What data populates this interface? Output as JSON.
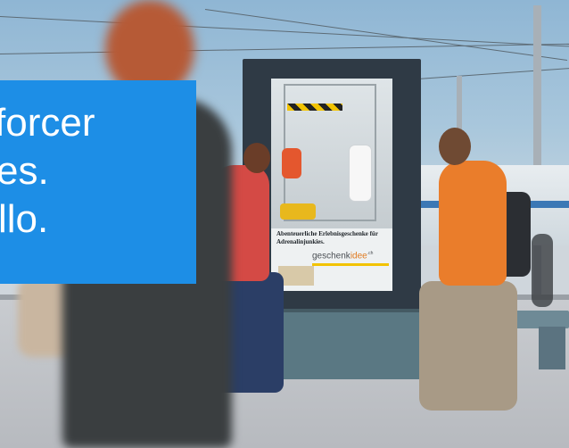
{
  "overlay": {
    "lines": [
      "forcer",
      "es.",
      "llo."
    ],
    "background_color": "#1d8ee6",
    "text_color": "#ffffff"
  },
  "screen_ad": {
    "headline": "Abenteuerliche Erlebnisgeschenke für Adrenalinjunkies.",
    "logo_main": "geschenk",
    "logo_accent": "idee",
    "logo_suffix": ".ch"
  }
}
